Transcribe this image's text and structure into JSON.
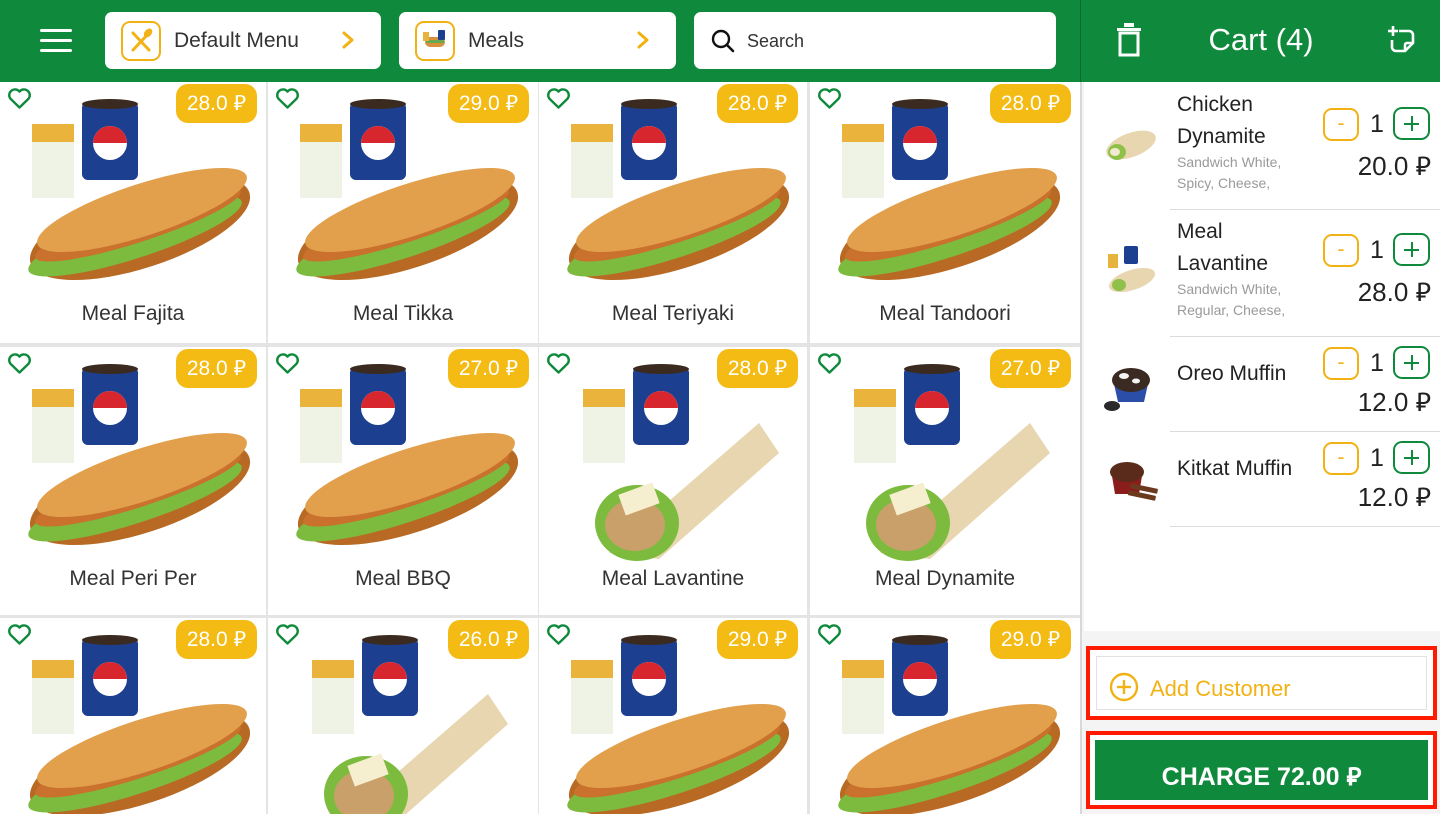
{
  "header": {
    "menu_selector": {
      "label": "Default Menu"
    },
    "category_selector": {
      "label": "Meals"
    },
    "search": {
      "placeholder": "Search"
    }
  },
  "currency_symbol": "⃁",
  "products": [
    {
      "name": "Meal Fajita",
      "price": "28.0 ⃁",
      "image": "sub-meal"
    },
    {
      "name": "Meal Tikka",
      "price": "29.0 ⃁",
      "image": "sub-meal"
    },
    {
      "name": "Meal Teriyaki",
      "price": "28.0 ⃁",
      "image": "sub-meal"
    },
    {
      "name": "Meal Tandoori",
      "price": "28.0 ⃁",
      "image": "sub-meal"
    },
    {
      "name": "Meal Peri Per",
      "price": "28.0 ⃁",
      "image": "sub-meal"
    },
    {
      "name": "Meal BBQ",
      "price": "27.0 ⃁",
      "image": "sub-meal"
    },
    {
      "name": "Meal Lavantine",
      "price": "28.0 ⃁",
      "image": "wrap-meal"
    },
    {
      "name": "Meal Dynamite",
      "price": "27.0 ⃁",
      "image": "wrap-meal"
    },
    {
      "name": "",
      "price": "28.0 ⃁",
      "image": "sub-meal"
    },
    {
      "name": "",
      "price": "26.0 ⃁",
      "image": "wrap-meal"
    },
    {
      "name": "",
      "price": "29.0 ⃁",
      "image": "sub-meal"
    },
    {
      "name": "",
      "price": "29.0 ⃁",
      "image": "sub-meal"
    }
  ],
  "cart": {
    "title": "Cart (4)",
    "items": [
      {
        "name": "Chicken Dynamite",
        "modifiers": "Sandwich White, Spicy, Cheese,",
        "qty": "1",
        "price": "20.0 ⃁",
        "thumb": "wrap-icon"
      },
      {
        "name": "Meal Lavantine",
        "modifiers": "Sandwich White, Regular, Cheese,",
        "qty": "1",
        "price": "28.0 ⃁",
        "thumb": "meal-icon"
      },
      {
        "name": "Oreo Muffin",
        "modifiers": "",
        "qty": "1",
        "price": "12.0 ⃁",
        "thumb": "muffin-icon"
      },
      {
        "name": "Kitkat Muffin",
        "modifiers": "",
        "qty": "1",
        "price": "12.0 ⃁",
        "thumb": "muffin-icon"
      }
    ],
    "minus_label": "-",
    "add_customer_label": "Add Customer",
    "charge_label": "CHARGE 72.00 ⃁"
  },
  "colors": {
    "primary_green": "#0f8a3c",
    "accent_yellow": "#f4bb14",
    "highlight_red": "#ff1a00"
  }
}
